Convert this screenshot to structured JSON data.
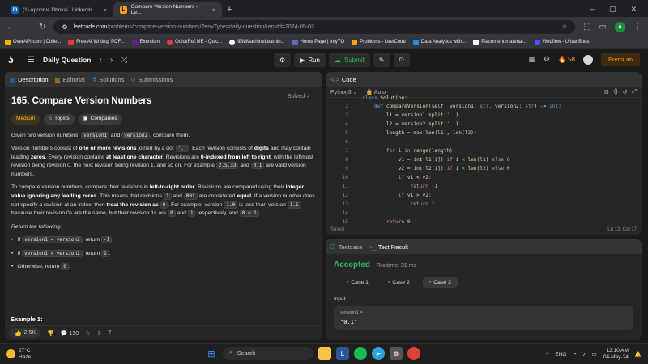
{
  "browser": {
    "tabs": [
      {
        "label": "(1) Apoorva Dhokai | LinkedIn",
        "icon": "linkedin-icon"
      },
      {
        "label": "Compare Version Numbers - Le...",
        "icon": "leetcode-icon"
      }
    ],
    "url_host": "leetcode.com",
    "url_path": "/problems/compare-version-numbers/?envType=daily-question&envId=2024-05-03",
    "profile_initial": "A",
    "bookmarks": [
      "OverAPI.com | Colle...",
      "Free AI Writing, PDF...",
      "Exercism",
      "QuickRef.ME - Quic...",
      "IBMMachineLearnin...",
      "Home Page | InfyTQ",
      "Problems - LeetCode",
      "Data Analytics with...",
      "Placement material...",
      "Webflow - UrbanBites"
    ]
  },
  "nav": {
    "title": "Daily Question",
    "run": "Run",
    "submit": "Submit",
    "streak": "58",
    "premium": "Premium"
  },
  "left": {
    "tabs": [
      "Description",
      "Editorial",
      "Solutions",
      "Submissions"
    ],
    "title": "165. Compare Version Numbers",
    "solved": "Solved",
    "chips": [
      "Medium",
      "Topics",
      "Companies"
    ],
    "example_heading": "Example 1:",
    "likes": "2.5K",
    "comments": "130"
  },
  "code": {
    "header": "Code",
    "language": "Python3",
    "autosave": "Auto",
    "saved": "Saved",
    "cursor": "Ln 13, Col 17"
  },
  "result": {
    "tabs": [
      "Testcase",
      "Test Result"
    ],
    "status": "Accepted",
    "runtime": "Runtime: 31 ms",
    "cases": [
      "Case 1",
      "Case 2",
      "Case 3"
    ],
    "input_label": "Input",
    "var_name": "version1 =",
    "var_value": "\"0.1\""
  },
  "taskbar": {
    "temp": "27°C",
    "weather": "Haze",
    "search": "Search",
    "lang": "ENG",
    "time": "12:10 AM",
    "date": "04-May-24"
  }
}
